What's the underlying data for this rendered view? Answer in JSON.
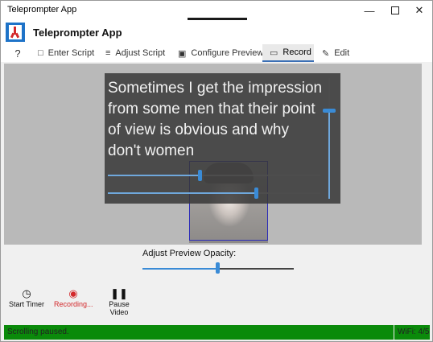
{
  "window": {
    "title": "Teleprompter App"
  },
  "app": {
    "title": "Teleprompter App"
  },
  "tabs": [
    {
      "label": "?",
      "icon": "help-icon"
    },
    {
      "label": "Enter Script",
      "icon": "chat-icon"
    },
    {
      "label": "Adjust Script",
      "icon": "list-icon"
    },
    {
      "label": "Configure Preview",
      "icon": "portrait-icon"
    },
    {
      "label": "Record",
      "icon": "camera-icon",
      "active": true
    },
    {
      "label": "Edit",
      "icon": "pencil-icon"
    }
  ],
  "preview": {
    "script_text": "Sometimes I get the impression from some men that their point of view is obvious and why don't women"
  },
  "controls": {
    "opacity_label": "Adjust Preview Opacity:",
    "opacity_value": 0.5,
    "start_timer": "Start Timer",
    "recording": "Recording...",
    "pause_video": "Pause Video"
  },
  "status": {
    "message": "Scrolling paused.",
    "wifi": "WiFi: 4/5",
    "color": "#0a8a0a"
  }
}
